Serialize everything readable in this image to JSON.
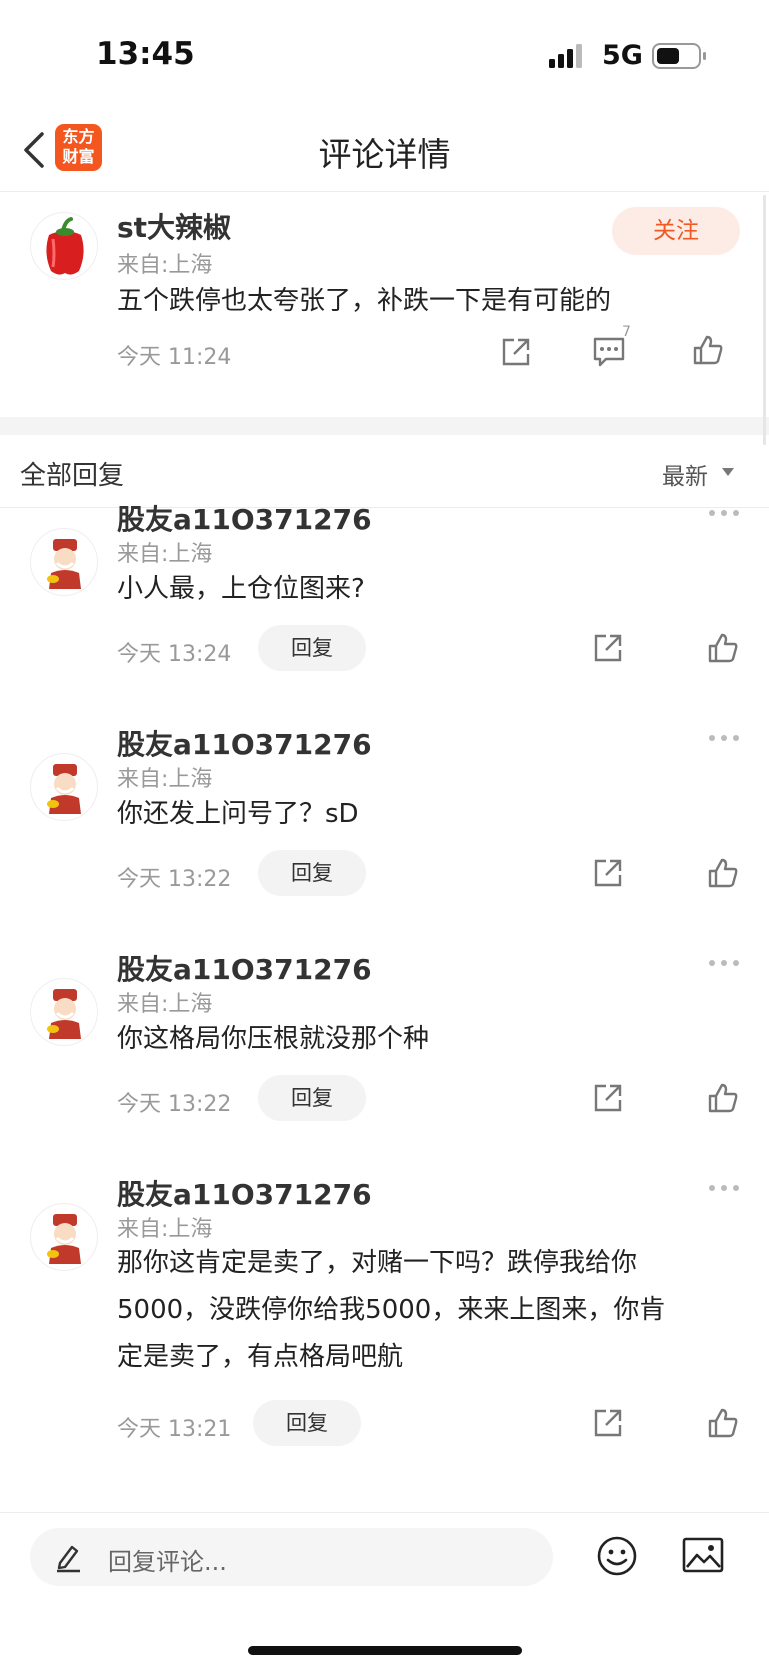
{
  "status": {
    "time": "13:45",
    "network": "5G"
  },
  "nav": {
    "logo_line1": "东方",
    "logo_line2": "财富",
    "title": "评论详情"
  },
  "main_comment": {
    "username": "st大辣椒",
    "location": "来自:上海",
    "follow_label": "关注",
    "content": "五个跌停也太夸张了，补跌一下是有可能的",
    "time": "今天 11:24",
    "comment_count": "7"
  },
  "replies_header": {
    "title": "全部回复",
    "sort": "最新"
  },
  "replies": [
    {
      "username": "股友a11O371276",
      "location": "来自:上海",
      "content": "小人最，上仓位图来?",
      "time": "今天 13:24",
      "reply_label": "回复"
    },
    {
      "username": "股友a11O371276",
      "location": "来自:上海",
      "content": "你还发上问号了？sD",
      "time": "今天 13:22",
      "reply_label": "回复"
    },
    {
      "username": "股友a11O371276",
      "location": "来自:上海",
      "content": "你这格局你压根就没那个种",
      "time": "今天 13:22",
      "reply_label": "回复"
    },
    {
      "username": "股友a11O371276",
      "location": "来自:上海",
      "content_line1": "那你这肯定是卖了，对赌一下吗？跌停我给你",
      "content_line2": "5000，没跌停你给我5000，来来上图来，你肯",
      "content_line3": "定是卖了，有点格局吧航",
      "time": "今天 13:21",
      "reply_label": "回复"
    }
  ],
  "bottom": {
    "input_placeholder": "回复评论..."
  },
  "colors": {
    "accent": "#f05a22",
    "logo_bg": "#f4561f",
    "muted": "#999999"
  }
}
